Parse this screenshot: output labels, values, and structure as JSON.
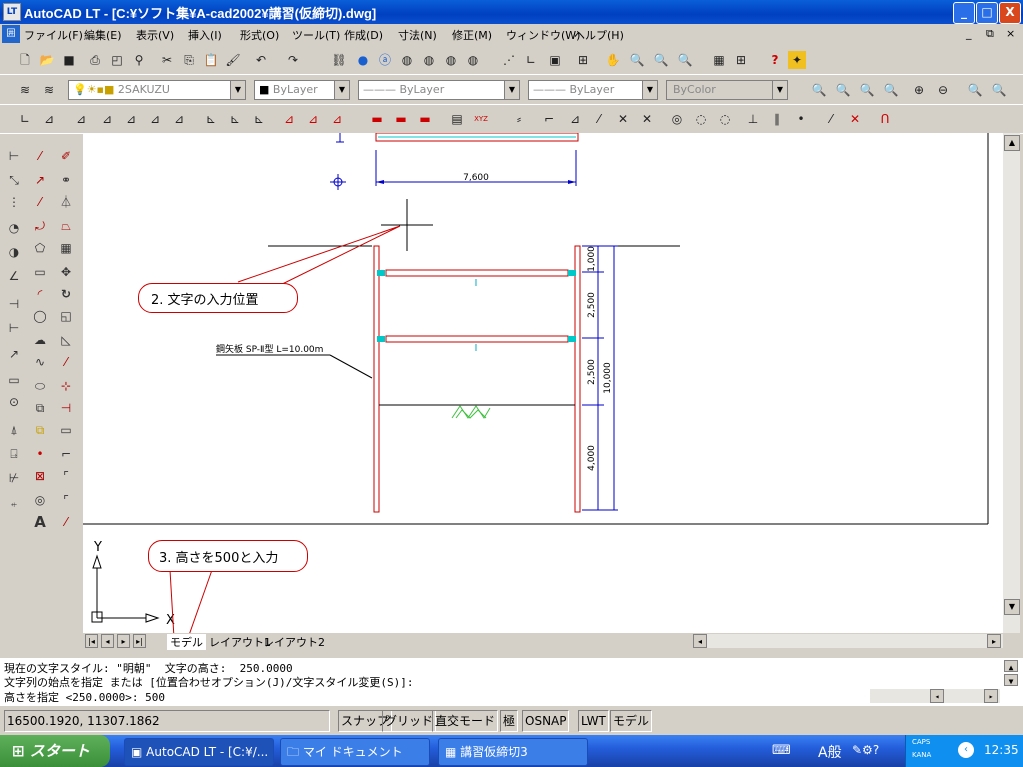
{
  "window": {
    "title": "AutoCAD LT - [C:¥ソフト集¥A-cad2002¥講習(仮締切).dwg]",
    "minimize": "_",
    "maximize": "□",
    "close": "X"
  },
  "menu": [
    "ファイル(F)",
    "編集(E)",
    "表示(V)",
    "挿入(I)",
    "形式(O)",
    "ツール(T)",
    "作成(D)",
    "寸法(N)",
    "修正(M)",
    "ウィンドウ(W)",
    "ヘルプ(H)"
  ],
  "layer_toolbar": {
    "layer": "2SAKUZU",
    "color": "ByLayer",
    "linetype": "ByLayer",
    "lineweight": "ByLayer",
    "plotstyle": "ByColor"
  },
  "drawing": {
    "dim_top": "7,600",
    "dims_right": [
      "1,000",
      "2,500",
      "2,500",
      "4,000"
    ],
    "dim_total": "10,000",
    "sheet_label": "鋼矢板 SP-Ⅱ型 L=10.00m",
    "ucs_y": "Y",
    "ucs_x": "X"
  },
  "callouts": {
    "step2": "2. 文字の入力位置",
    "step3": "3. 高さを500と入力"
  },
  "layout_tabs": [
    "モデル",
    "レイアウト1",
    "レイアウト2"
  ],
  "command": {
    "line1": "現在の文字スタイル: \"明朝\"  文字の高さ:  250.0000",
    "line2": "文字列の始点を指定 または [位置合わせオプション(J)/文字スタイル変更(S)]:",
    "line3": "高さを指定 <250.0000>: 500"
  },
  "status": {
    "coords": "16500.1920, 11307.1862",
    "buttons": [
      "スナップ",
      "グリッド",
      "直交モード",
      "極",
      "OSNAP",
      "LWT",
      "モデル"
    ]
  },
  "taskbar": {
    "start": "スタート",
    "tasks": [
      "AutoCAD LT - [C:¥/...",
      "マイ ドキュメント",
      "講習仮締切3"
    ],
    "ime": "A般",
    "caps": "CAPS",
    "kana": "KANA",
    "clock": "12:35"
  },
  "colors": {
    "title": "#0a5fd8",
    "drawing_bg": "#ffffff",
    "dim_blue": "#0000c8",
    "sheet_red": "#c80000",
    "strut_cyan": "#00c8c8",
    "hatch_green": "#40c040"
  }
}
